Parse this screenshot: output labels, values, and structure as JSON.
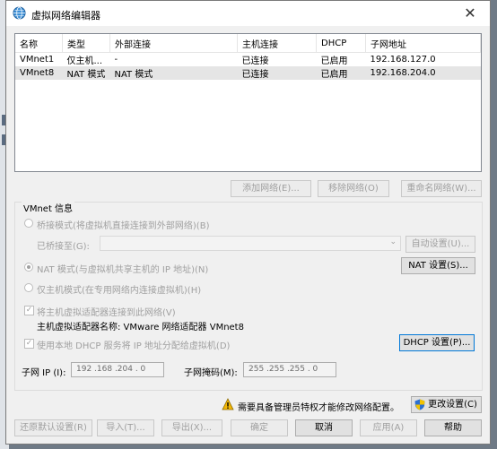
{
  "window": {
    "title": "虚拟网络编辑器",
    "close_glyph": "✕"
  },
  "table": {
    "columns": [
      "名称",
      "类型",
      "外部连接",
      "主机连接",
      "DHCP",
      "子网地址"
    ],
    "rows": [
      [
        "VMnet1",
        "仅主机...",
        "-",
        "已连接",
        "已启用",
        "192.168.127.0"
      ],
      [
        "VMnet8",
        "NAT 模式",
        "NAT 模式",
        "已连接",
        "已启用",
        "192.168.204.0"
      ]
    ]
  },
  "list_buttons": {
    "add": "添加网络(E)...",
    "remove": "移除网络(O)",
    "rename": "重命名网络(W)..."
  },
  "vmnet_info": {
    "group_label": "VMnet 信息",
    "bridge_radio": "桥接模式(将虚拟机直接连接到外部网络)(B)",
    "bridged_to_label": "已桥接至(G):",
    "auto_settings": "自动设置(U)...",
    "nat_radio": "NAT 模式(与虚拟机共享主机的 IP 地址)(N)",
    "nat_settings": "NAT 设置(S)...",
    "hostonly_radio": "仅主机模式(在专用网络内连接虚拟机)(H)",
    "connect_adapter": "将主机虚拟适配器连接到此网络(V)",
    "adapter_name": "主机虚拟适配器名称: VMware 网络适配器 VMnet8",
    "use_dhcp": "使用本地 DHCP 服务将 IP 地址分配给虚拟机(D)",
    "dhcp_settings": "DHCP 设置(P)...",
    "subnet_ip_label": "子网 IP (I):",
    "subnet_ip": "192 .168 .204 . 0",
    "subnet_mask_label": "子网掩码(M):",
    "subnet_mask": "255 .255 .255 . 0"
  },
  "admin_notice": "需要具备管理员特权才能修改网络配置。",
  "change_settings": "更改设置(C)",
  "footer": {
    "restore": "还原默认设置(R)",
    "import": "导入(T)...",
    "export": "导出(X)...",
    "ok": "确定",
    "cancel": "取消",
    "apply": "应用(A)",
    "help": "帮助"
  },
  "colors": {
    "accent": "#0078d7",
    "disabled_text": "#a0a0a0",
    "selection": "#e5e5e5",
    "warning": "#f2b705"
  }
}
